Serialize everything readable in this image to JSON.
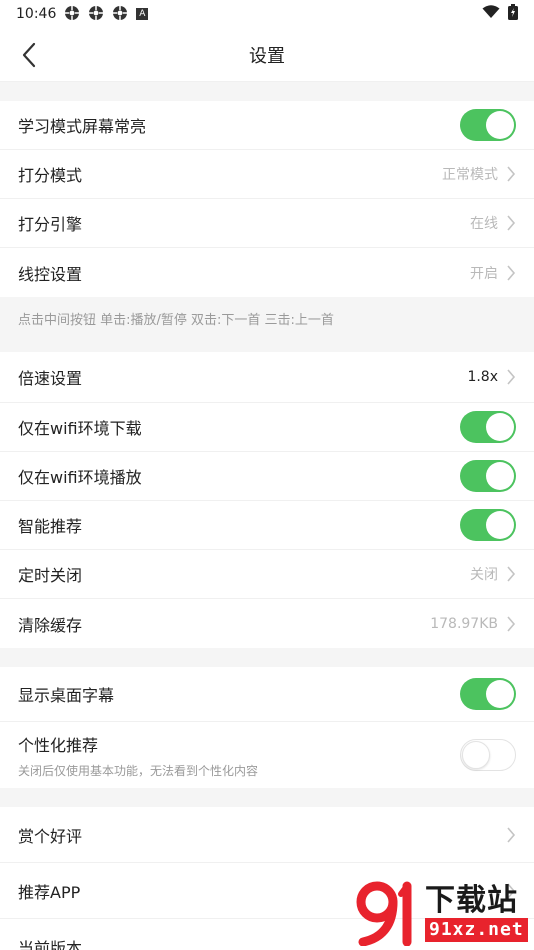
{
  "status_bar": {
    "time": "10:46",
    "notif_badge": "A"
  },
  "nav": {
    "title": "设置"
  },
  "section1": [
    {
      "label": "学习模式屏幕常亮",
      "toggle": true
    },
    {
      "label": "打分模式",
      "value": "正常模式"
    },
    {
      "label": "打分引擎",
      "value": "在线"
    },
    {
      "label": "线控设置",
      "value": "开启"
    }
  ],
  "hint": "点击中间按钮 单击:播放/暂停 双击:下一首 三击:上一首",
  "section2": [
    {
      "label": "倍速设置",
      "value": "1.8x"
    },
    {
      "label": "仅在wifi环境下载",
      "toggle": true
    },
    {
      "label": "仅在wifi环境播放",
      "toggle": true
    },
    {
      "label": "智能推荐",
      "toggle": true
    },
    {
      "label": "定时关闭",
      "value": "关闭"
    },
    {
      "label": "清除缓存",
      "value": "178.97KB"
    }
  ],
  "section3": [
    {
      "label": "显示桌面字幕",
      "toggle": true
    },
    {
      "label": "个性化推荐",
      "sub": "关闭后仅使用基本功能，无法看到个性化内容",
      "toggle": false
    }
  ],
  "section4": [
    {
      "label": "赏个好评"
    },
    {
      "label": "推荐APP"
    },
    {
      "label": "当前版本"
    }
  ],
  "watermark": {
    "cn": "下载站",
    "url": "91xz.net"
  },
  "colors": {
    "toggle_on": "#4cc35f",
    "watermark_red": "#e8232d"
  }
}
